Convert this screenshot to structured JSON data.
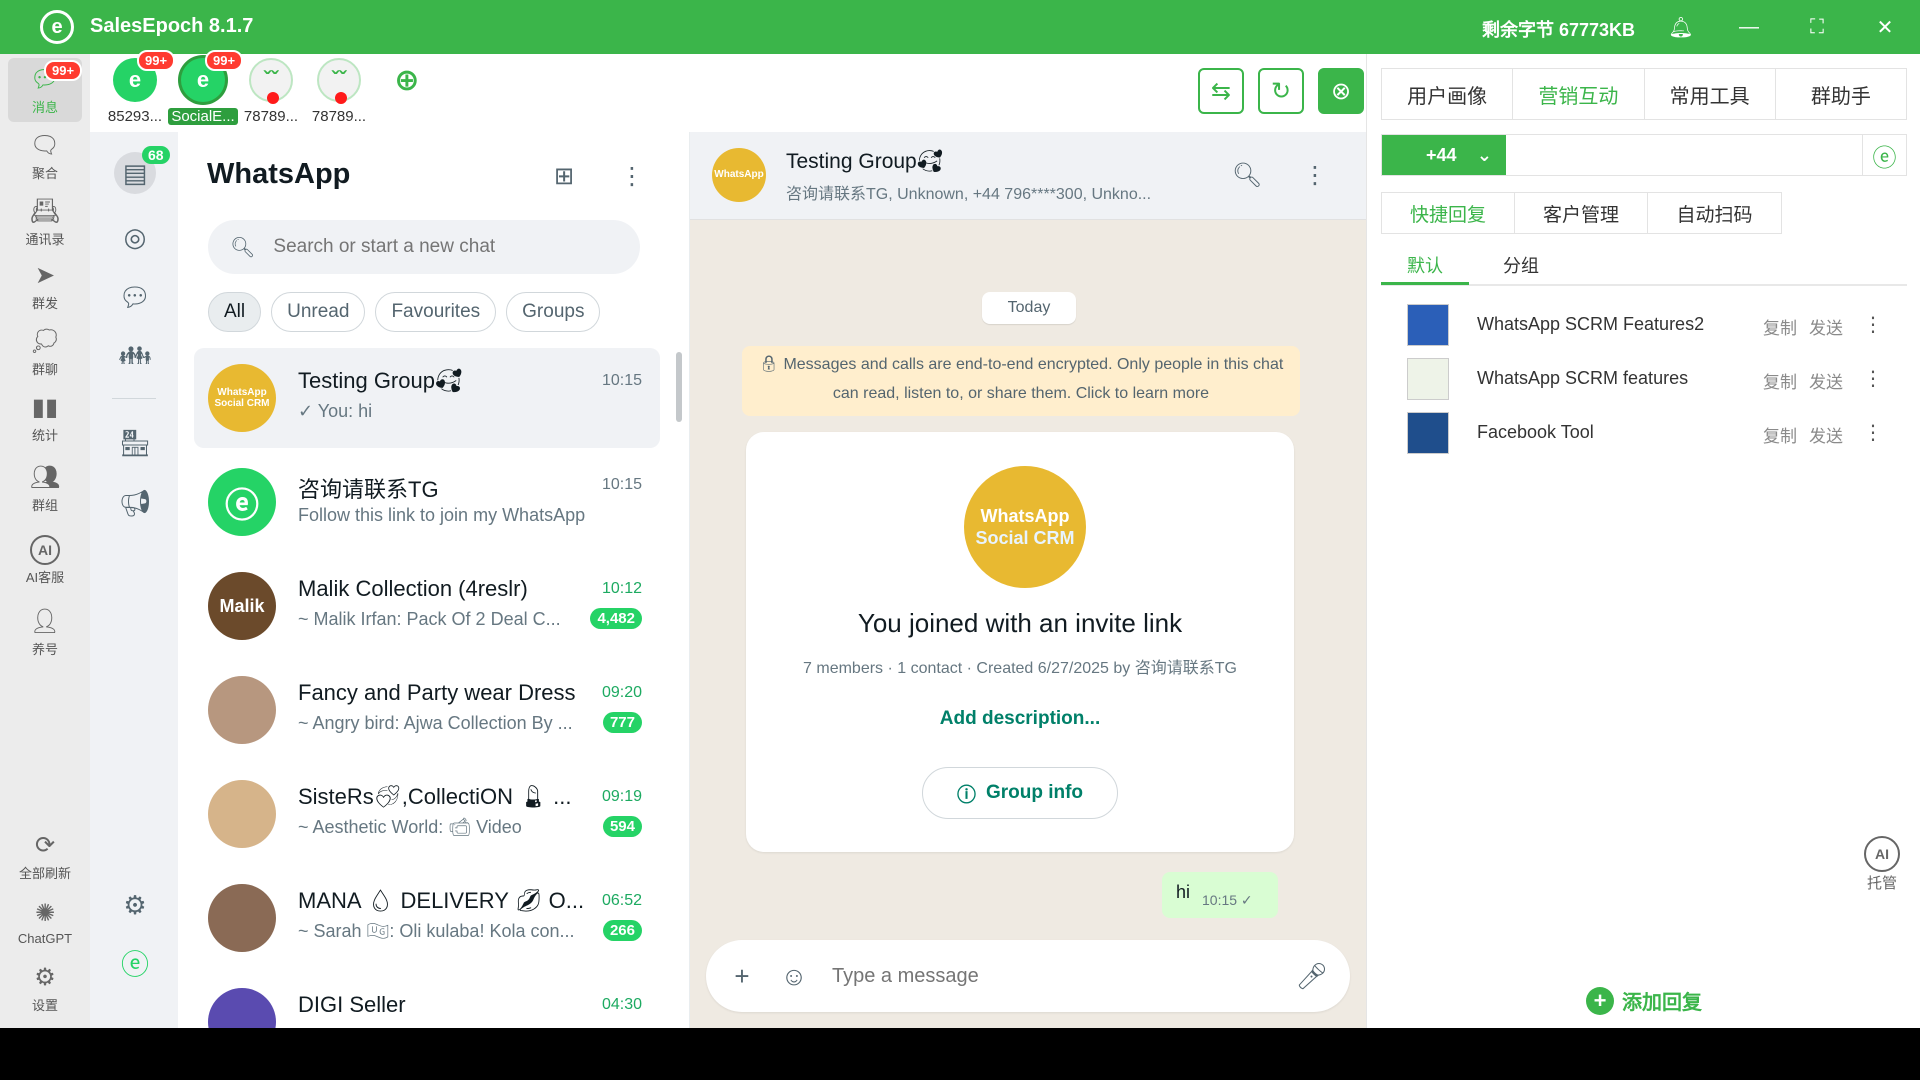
{
  "titlebar": {
    "app_title": "SalesEpoch 8.1.7",
    "quota": "剩余字节 67773KB"
  },
  "nav": {
    "items": [
      {
        "label": "消息",
        "icon": "chat-icon",
        "badge": "99+"
      },
      {
        "label": "聚合",
        "icon": "aggregate-icon"
      },
      {
        "label": "通讯录",
        "icon": "contacts-icon"
      },
      {
        "label": "群发",
        "icon": "send-icon"
      },
      {
        "label": "群聊",
        "icon": "group-chat-icon"
      },
      {
        "label": "统计",
        "icon": "stats-icon"
      },
      {
        "label": "群组",
        "icon": "groups-icon"
      },
      {
        "label": "AI客服",
        "icon": "ai-icon"
      },
      {
        "label": "养号",
        "icon": "account-nurture-icon"
      }
    ],
    "bottom": [
      {
        "label": "全部刷新",
        "icon": "refresh-all-icon"
      },
      {
        "label": "ChatGPT",
        "icon": "chatgpt-icon"
      },
      {
        "label": "设置",
        "icon": "settings-icon"
      }
    ]
  },
  "accounts": [
    {
      "label": "85293...",
      "badge": "99+"
    },
    {
      "label": "SocialE...",
      "badge": "99+",
      "selected": true
    },
    {
      "label": "78789..."
    },
    {
      "label": "78789..."
    }
  ],
  "rail": {
    "chats_badge": "68"
  },
  "chatlist": {
    "title": "WhatsApp",
    "search_placeholder": "Search or start a new chat",
    "filters": [
      "All",
      "Unread",
      "Favourites",
      "Groups"
    ],
    "chats": [
      {
        "name": "Testing Group🥰",
        "msg": "✓ You: hi",
        "time": "10:15"
      },
      {
        "name": "咨询请联系TG",
        "msg": "Follow this link to join my WhatsApp ...",
        "time": "10:15"
      },
      {
        "name": "Malik Collection (4reslr)",
        "msg": "~ Malik Irfan: Pack Of 2 Deal C...",
        "time": "10:12",
        "badge": "4,482",
        "avatar_text": "Malik"
      },
      {
        "name": "Fancy and Party wear Dress",
        "msg": "~ Angry bird: Ajwa Collection By ...",
        "time": "09:20",
        "badge": "777"
      },
      {
        "name": "SisteRs💞,CollectiON 💄 ...",
        "msg": "~ Aesthetic World: 📹 Video",
        "time": "09:19",
        "badge": "594"
      },
      {
        "name": "MANA 💧 DELIVERY 💋 O...",
        "msg": "~ Sarah 🇺🇬: Oli kulaba! Kola con...",
        "time": "06:52",
        "badge": "266"
      },
      {
        "name": "DIGI Seller",
        "msg": "",
        "time": "04:30"
      }
    ]
  },
  "convo": {
    "name": "Testing Group🥰",
    "subtitle": "咨询请联系TG, Unknown, +44 796****300, Unkno...",
    "date": "Today",
    "encryption": "🔒 Messages and calls are end-to-end encrypted. Only people in this chat can read, listen to, or share them. Click to learn more",
    "avatar_line1": "WhatsApp",
    "avatar_line2": "Social CRM",
    "joined": "You joined with an invite link",
    "meta": "7 members · 1 contact · Created 6/27/2025 by 咨询请联系TG",
    "add_description": "Add description...",
    "group_info": "Group info",
    "out_msg": {
      "text": "hi",
      "time": "10:15 ✓"
    },
    "composer_placeholder": "Type a message"
  },
  "rpanel": {
    "tabs": [
      "用户画像",
      "营销互动",
      "常用工具",
      "群助手"
    ],
    "country_code": "+44",
    "subtabs": [
      "快捷回复",
      "客户管理",
      "自动扫码"
    ],
    "groups": [
      "默认",
      "分组"
    ],
    "replies": [
      {
        "title": "WhatsApp SCRM Features2"
      },
      {
        "title": "WhatsApp SCRM features"
      },
      {
        "title": "Facebook Tool"
      }
    ],
    "copy_label": "复制",
    "send_label": "发送",
    "ai_label": "托管",
    "add_reply": "添加回复"
  },
  "colors": {
    "brand": "#3bb54a",
    "wa_green": "#25d366",
    "badge_red": "#ff3b30"
  }
}
